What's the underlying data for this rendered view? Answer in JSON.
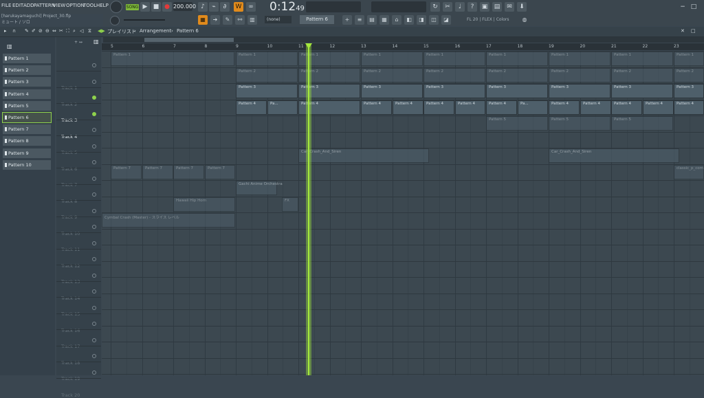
{
  "menu": [
    "FILE",
    "EDIT",
    "ADD",
    "PATTERN",
    "VIEW",
    "OPTION",
    "TOOL",
    "HELP"
  ],
  "transport": {
    "mode": "SONG",
    "tempo": "200.000",
    "time_main": "0:12",
    "time_sub": "49"
  },
  "project": {
    "title": "[harukayamaguchi] Project_30.flp",
    "hint": "ミュート / ソロ"
  },
  "toolbar2": {
    "pattern_select": "Pattern 6",
    "none": "(none)",
    "status": "FL 20 | FLEX | Colors"
  },
  "breadcrumb": {
    "playlist": "プレイリスト",
    "sep1": "›",
    "arrangement": "Arrangement",
    "sep2": "›",
    "pattern": "Pattern 6"
  },
  "patterns": [
    "Pattern 1",
    "Pattern 2",
    "Pattern 3",
    "Pattern 4",
    "Pattern 5",
    "Pattern 6",
    "Pattern 7",
    "Pattern 8",
    "Pattern 9",
    "Pattern 10"
  ],
  "selected_pattern_index": 5,
  "tracks": [
    {
      "name": "Track 1",
      "active": false
    },
    {
      "name": "Track 2",
      "active": false
    },
    {
      "name": "Track 3",
      "active": true
    },
    {
      "name": "Track 4",
      "active": true
    },
    {
      "name": "Track 5",
      "active": false
    },
    {
      "name": "Track 6",
      "active": false
    },
    {
      "name": "Track 7",
      "active": false
    },
    {
      "name": "Track 8",
      "active": false
    },
    {
      "name": "Track 9",
      "active": false
    },
    {
      "name": "Track 10",
      "active": false
    },
    {
      "name": "Track 11",
      "active": false
    },
    {
      "name": "Track 12",
      "active": false
    },
    {
      "name": "Track 13",
      "active": false
    },
    {
      "name": "Track 14",
      "active": false
    },
    {
      "name": "Track 15",
      "active": false
    },
    {
      "name": "Track 16",
      "active": false
    },
    {
      "name": "Track 17",
      "active": false
    },
    {
      "name": "Track 18",
      "active": false
    },
    {
      "name": "Track 19",
      "active": false
    },
    {
      "name": "Track 20",
      "active": false
    }
  ],
  "ruler": [
    "5",
    "6",
    "7",
    "8",
    "9",
    "10",
    "11",
    "12",
    "13",
    "14",
    "15",
    "16",
    "17",
    "18",
    "19",
    "20",
    "21",
    "22",
    "23"
  ],
  "clips": {
    "p1": "Pattern 1",
    "p2": "Pattern 2",
    "p3": "Pattern 3",
    "p4": "Pattern 4",
    "p4s": "Pa...",
    "p5": "Pattern 5",
    "p7": "Pattern 7",
    "car": "Car_Crash_And_Siren",
    "gachi": "Gachi Anime Orchestra",
    "hip": "Hawaii Hip Horn",
    "fx": "FX",
    "cym": "Cymbal Crash (Master) - スライス レベル",
    "classic": "classic_p_com"
  }
}
